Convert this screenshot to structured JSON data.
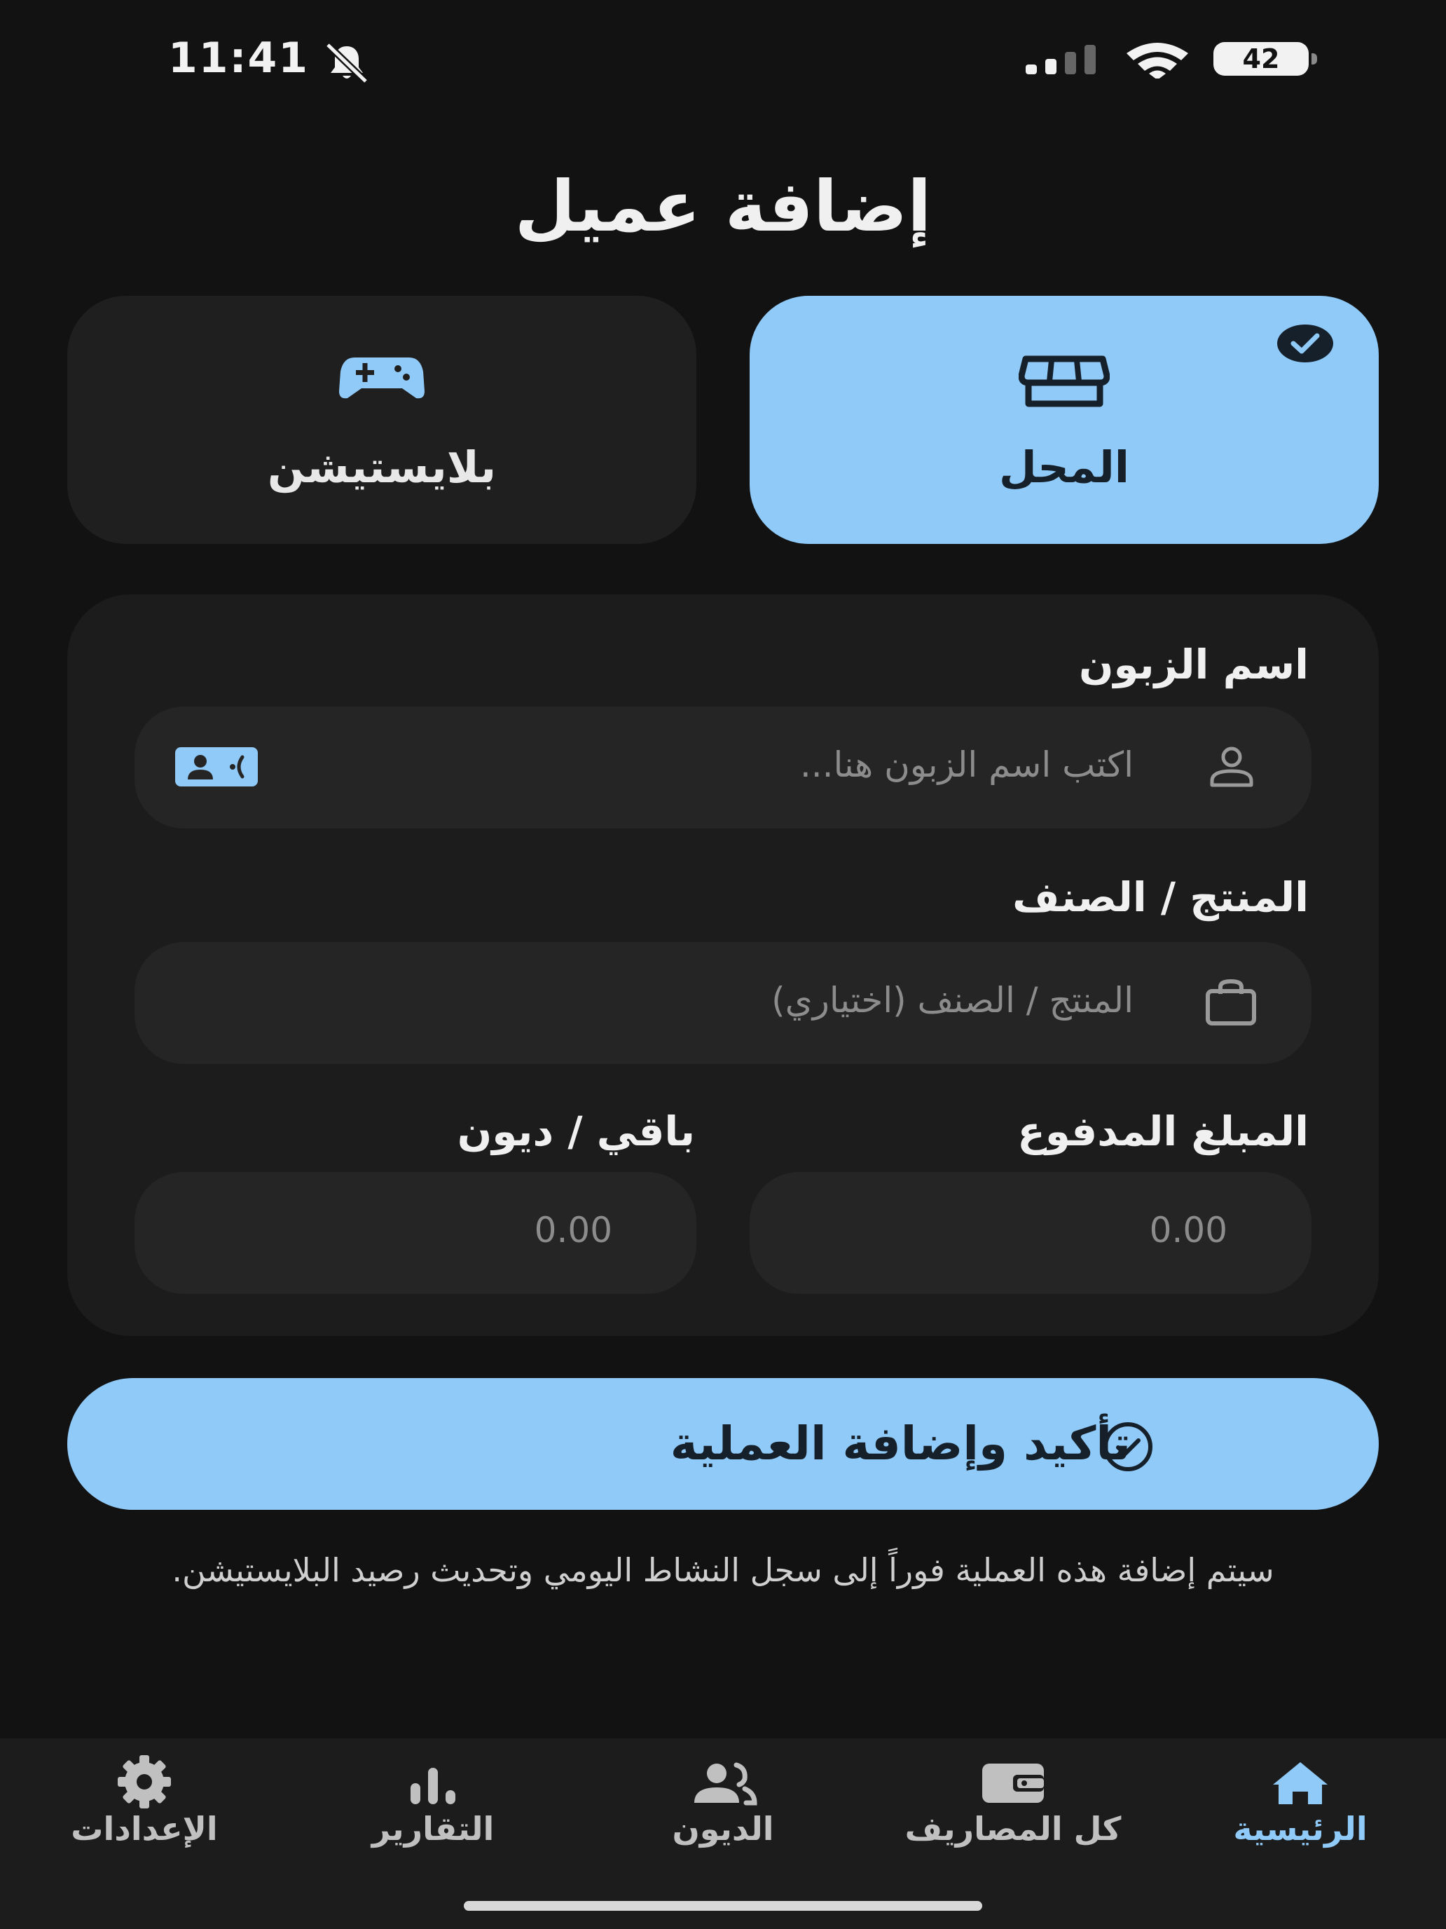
{
  "status_bar": {
    "time": "11:41",
    "battery": "42"
  },
  "header": {
    "title": "إضافة عميل"
  },
  "type_selector": {
    "options": [
      {
        "label": "المحل",
        "icon": "store-icon",
        "selected": true
      },
      {
        "label": "بلايستيشن",
        "icon": "gamepad-icon",
        "selected": false
      }
    ]
  },
  "form": {
    "customer_name": {
      "label": "اسم الزبون",
      "placeholder": "اكتب اسم الزبون هنا..."
    },
    "product": {
      "label": "المنتج / الصنف",
      "placeholder": "المنتج / الصنف (اختياري)"
    },
    "amount_paid": {
      "label": "المبلغ المدفوع",
      "placeholder": "0.00"
    },
    "remaining_debt": {
      "label": "باقي / ديون",
      "placeholder": "0.00"
    }
  },
  "confirm_button": {
    "label": "تأكيد وإضافة العملية"
  },
  "note": "سيتم إضافة هذه العملية فوراً إلى سجل النشاط اليومي وتحديث رصيد البلايستيشن.",
  "bottom_nav": {
    "items": [
      {
        "label": "الرئيسية",
        "icon": "home-icon",
        "active": true
      },
      {
        "label": "كل المصاريف",
        "icon": "wallet-icon",
        "active": false
      },
      {
        "label": "الديون",
        "icon": "group-icon",
        "active": false
      },
      {
        "label": "التقارير",
        "icon": "bar-chart-icon",
        "active": false
      },
      {
        "label": "الإعدادات",
        "icon": "settings-icon",
        "active": false
      }
    ]
  },
  "colors": {
    "background": "#121212",
    "surface": "#1c1c1c",
    "input": "#252525",
    "accent": "#90caf9",
    "text": "#f0f0f0"
  }
}
